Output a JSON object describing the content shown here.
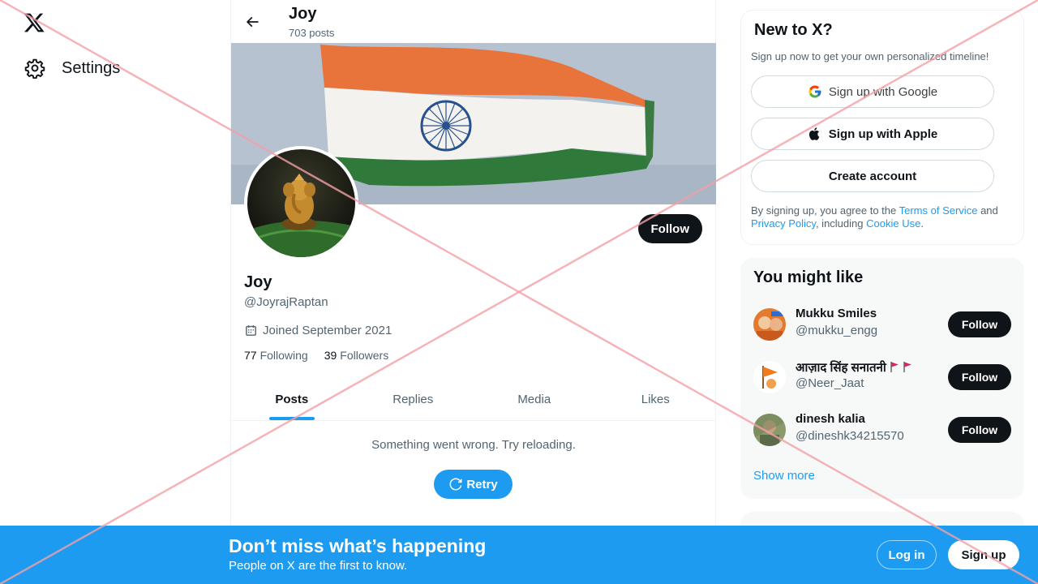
{
  "nav": {
    "settings_label": "Settings"
  },
  "topbar": {
    "name": "Joy",
    "posts_count": "703 posts"
  },
  "profile": {
    "name": "Joy",
    "handle": "@JoyrajRaptan",
    "joined": "Joined September 2021",
    "following_count": "77",
    "following_label": "Following",
    "followers_count": "39",
    "followers_label": "Followers",
    "follow_label": "Follow"
  },
  "tabs": [
    {
      "label": "Posts",
      "active": true
    },
    {
      "label": "Replies",
      "active": false
    },
    {
      "label": "Media",
      "active": false
    },
    {
      "label": "Likes",
      "active": false
    }
  ],
  "feed": {
    "error_message": "Something went wrong. Try reloading.",
    "retry_label": "Retry"
  },
  "signup_card": {
    "title": "New to X?",
    "subtitle": "Sign up now to get your own personalized timeline!",
    "google_label": "Sign up with Google",
    "apple_label": "Sign up with Apple",
    "create_label": "Create account",
    "terms_prefix": "By signing up, you agree to the",
    "terms_link": "Terms of Service",
    "terms_and": "and",
    "privacy_link": "Privacy Policy",
    "terms_including": ", including",
    "cookie_link": "Cookie Use",
    "terms_end": "."
  },
  "suggestions": {
    "title": "You might like",
    "items": [
      {
        "name": "Mukku Smiles",
        "handle": "@mukku_engg",
        "follow_label": "Follow"
      },
      {
        "name": "आज़ाद सिंह सनातनी",
        "handle": "@Neer_Jaat",
        "follow_label": "Follow"
      },
      {
        "name": "dinesh kalia",
        "handle": "@dineshk34215570",
        "follow_label": "Follow"
      }
    ],
    "show_more": "Show more"
  },
  "bottom_bar": {
    "title": "Don’t miss what’s happening",
    "subtitle": "People on X are the first to know.",
    "login_label": "Log in",
    "signup_label": "Sign up"
  },
  "colors": {
    "accent": "#1d9bf0",
    "text": "#0f1419",
    "secondary": "#536471",
    "overlay_x": "#f4a0a6"
  }
}
